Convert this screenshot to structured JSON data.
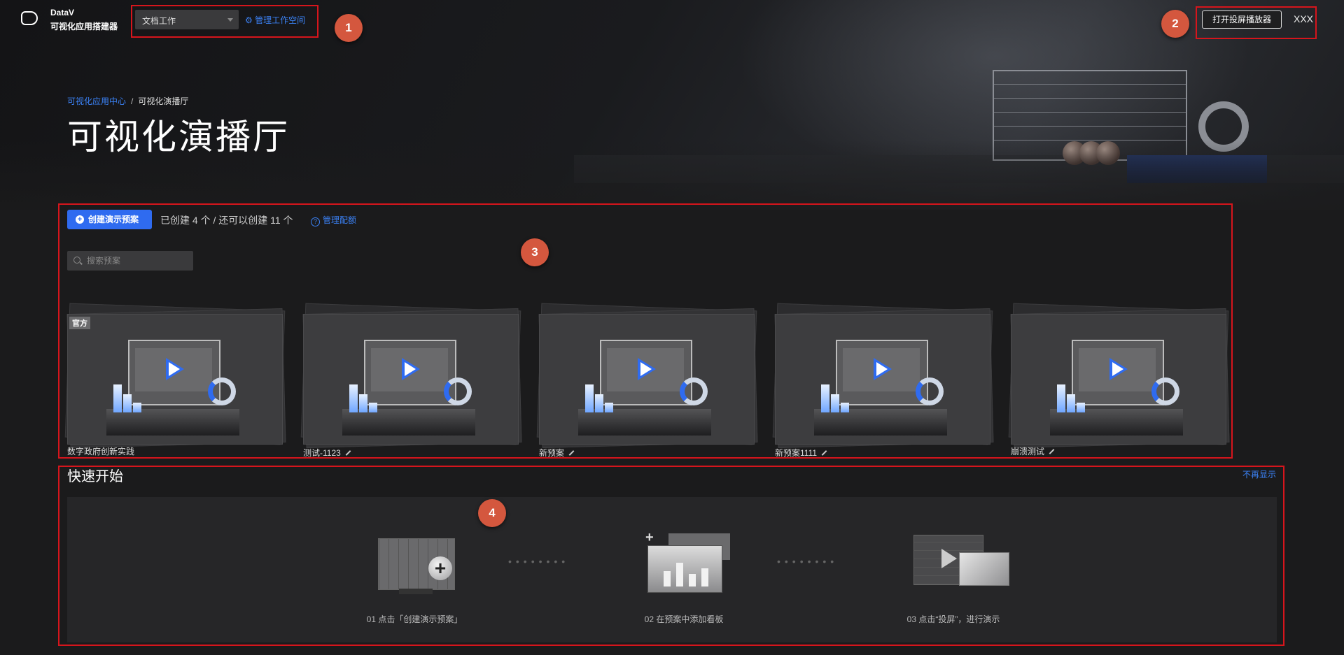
{
  "header": {
    "brand_line1": "DataV",
    "brand_line2": "可视化应用搭建器",
    "workspace_selected": "文档工作",
    "manage_workspace": "管理工作空间",
    "open_player": "打开投屏播放器",
    "user": "XXX"
  },
  "breadcrumb": {
    "parent": "可视化应用中心",
    "separator": "/",
    "current": "可视化演播厅"
  },
  "page_title": "可视化演播厅",
  "presets": {
    "create_label": "创建演示预案",
    "quota_text": "已创建 4 个 / 还可以创建 11 个",
    "manage_quota": "管理配额",
    "search_placeholder": "搜索预案",
    "official_tag": "官方",
    "cards": [
      {
        "title": "数字政府创新实践",
        "official": true,
        "editable": false
      },
      {
        "title": "测试-1123",
        "official": false,
        "editable": true
      },
      {
        "title": "新预案",
        "official": false,
        "editable": true
      },
      {
        "title": "新预案1111",
        "official": false,
        "editable": true
      },
      {
        "title": "崩溃测试",
        "official": false,
        "editable": true
      }
    ]
  },
  "quick_start": {
    "title": "快速开始",
    "hide_label": "不再显示",
    "steps": [
      {
        "label": "01 点击「创建演示预案」"
      },
      {
        "label": "02 在预案中添加看板"
      },
      {
        "label": "03 点击“投屏”，进行演示"
      }
    ]
  },
  "annotations": [
    "1",
    "2",
    "3",
    "4"
  ],
  "colors": {
    "accent": "#2f6bf0",
    "link": "#3b82f6",
    "annotation": "#d6151c",
    "marker": "#d4573e"
  }
}
